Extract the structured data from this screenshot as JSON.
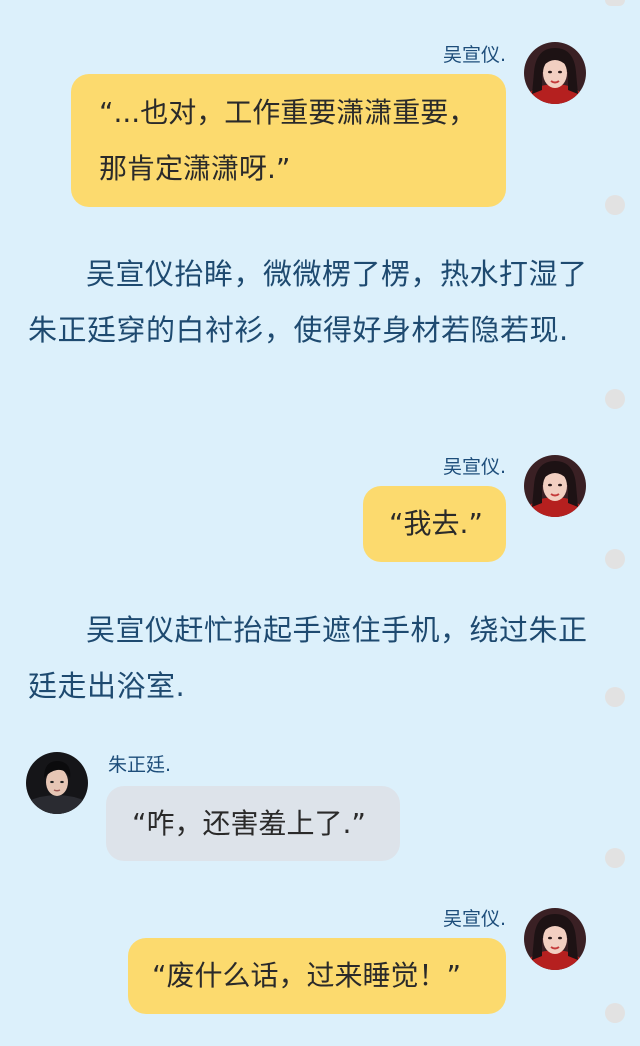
{
  "messages": {
    "m1": {
      "speaker": "吴宣仪.",
      "text": "“...也对，工作重要潇潇重要，那肯定潇潇呀.”"
    },
    "m2": {
      "speaker": "吴宣仪.",
      "text": "“我去.”"
    },
    "m3": {
      "speaker": "朱正廷.",
      "text": "“咋，还害羞上了.”"
    },
    "m4": {
      "speaker": "吴宣仪.",
      "text": "“废什么话，过来睡觉！”"
    }
  },
  "narration": {
    "p1": "吴宣仪抬眸，微微楞了楞，热水打湿了朱正廷穿的白衬衫，使得好身材若隐若现.",
    "p2": "吴宣仪赶忙抬起手遮住手机，绕过朱正廷走出浴室."
  },
  "colors": {
    "background": "#dcf0fb",
    "bubble_self": "#fcda6e",
    "bubble_other": "#dde3ea",
    "scroll_dots": "#e2e2e2"
  },
  "icons": {
    "avatar_self": "avatar-woman-icon",
    "avatar_other": "avatar-man-icon"
  }
}
